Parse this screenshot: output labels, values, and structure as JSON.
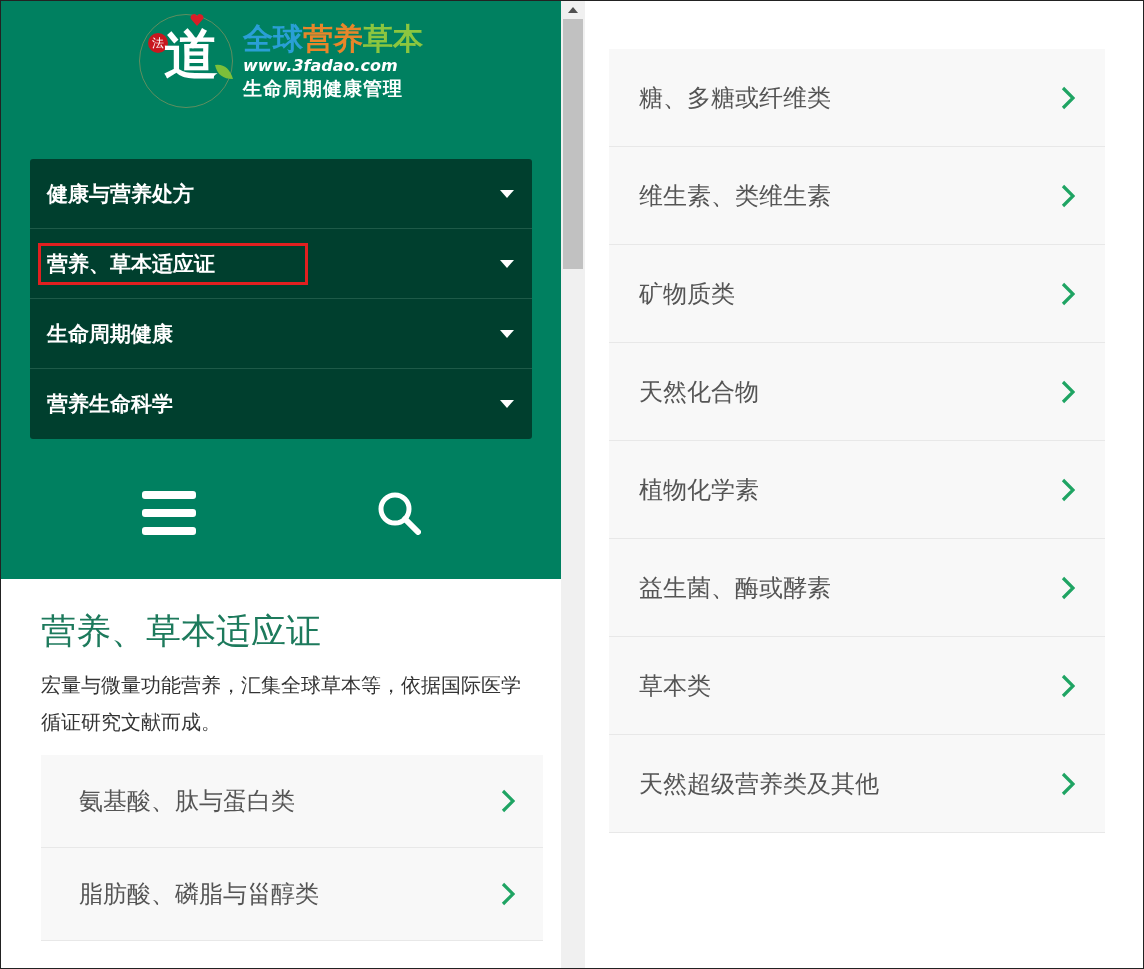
{
  "logo": {
    "emblem_seal": "法",
    "emblem_char": "道",
    "title_parts": [
      {
        "text": "全球",
        "color": "#2a9fd6"
      },
      {
        "text": "营养",
        "color": "#e8862a"
      },
      {
        "text": "草本",
        "color": "#8cc63f"
      }
    ],
    "url": "www.3fadao.com",
    "tagline": "生命周期健康管理"
  },
  "nav": [
    {
      "label": "健康与营养处方",
      "highlighted": false
    },
    {
      "label": "营养、草本适应证",
      "highlighted": true
    },
    {
      "label": "生命周期健康",
      "highlighted": false
    },
    {
      "label": "营养生命科学",
      "highlighted": false
    }
  ],
  "section": {
    "title": "营养、草本适应证",
    "description": "宏量与微量功能营养，汇集全球草本等，依据国际医学循证研究文献而成。",
    "items": [
      "氨基酸、肽与蛋白类",
      "脂肪酸、磷脂与甾醇类"
    ]
  },
  "right_items": [
    "糖、多糖或纤维类",
    "维生素、类维生素",
    "矿物质类",
    "天然化合物",
    "植物化学素",
    "益生菌、酶或酵素",
    "草本类",
    "天然超级营养类及其他"
  ]
}
